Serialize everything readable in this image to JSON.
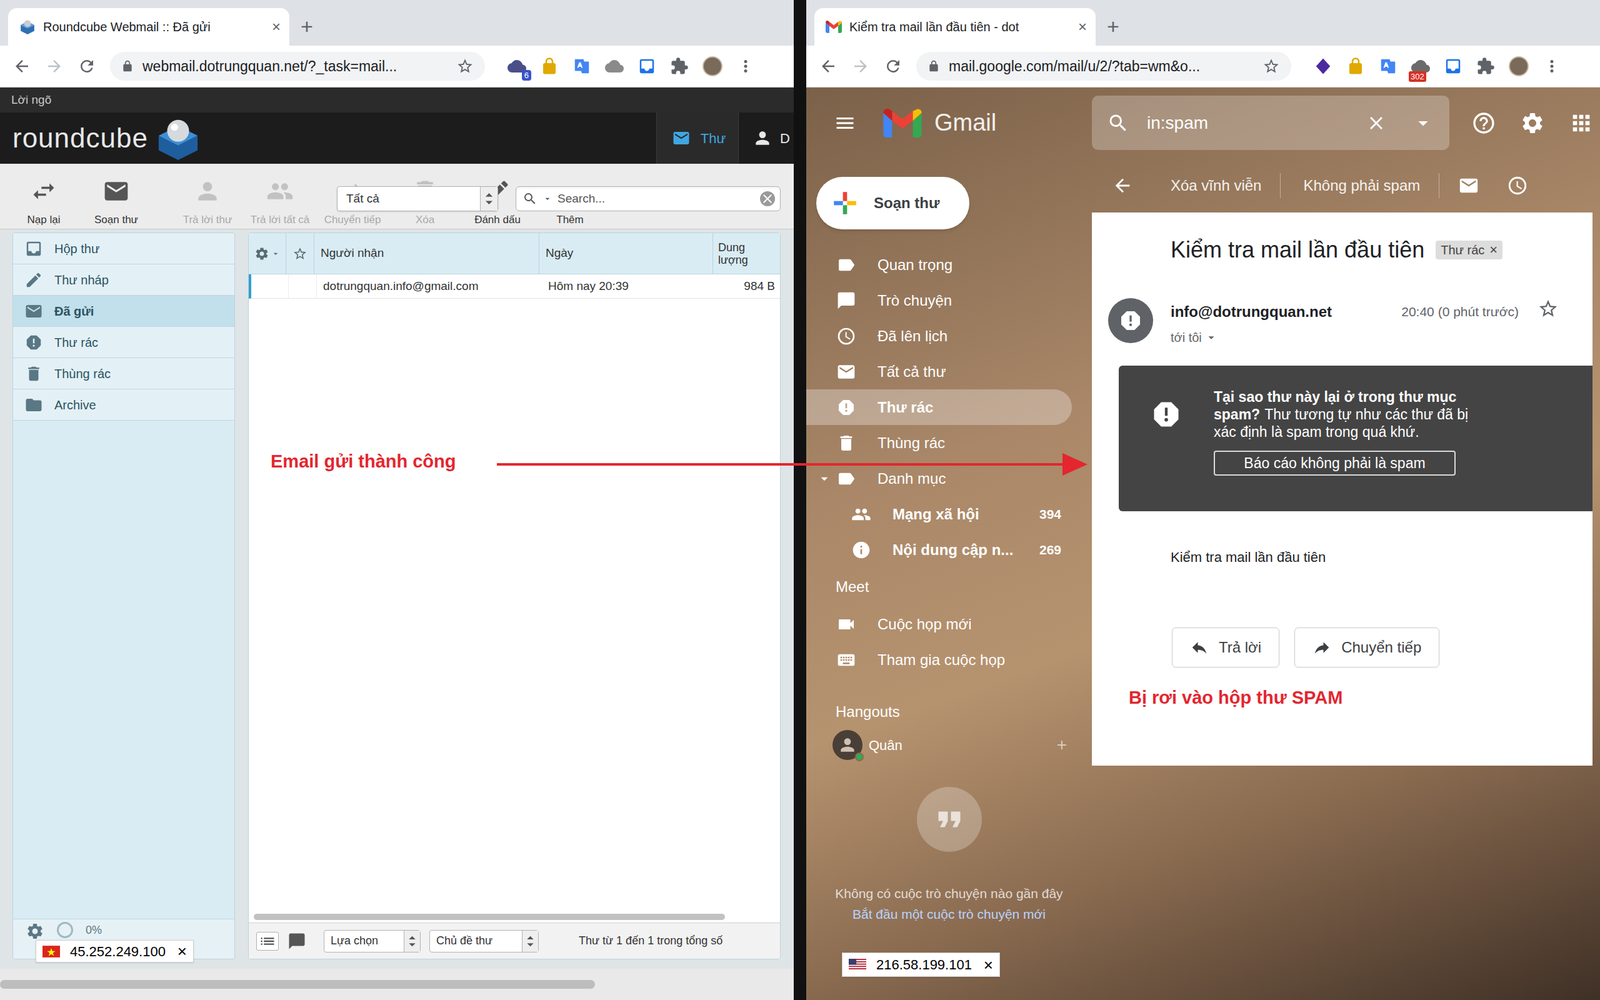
{
  "left_window": {
    "tab": {
      "title": "Roundcube Webmail :: Đã gửi",
      "close": "×"
    },
    "new_tab": "+",
    "url": "webmail.dotrungquan.net/?_task=mail...",
    "extension_badge": "6",
    "bookmarks": [
      "Lời ngõ"
    ]
  },
  "roundcube": {
    "logo": "roundcube",
    "header_tabs": [
      {
        "label": "Thư",
        "selected": true
      },
      {
        "label": "D",
        "selected": false
      }
    ],
    "toolbar": [
      {
        "label": "Nạp lại",
        "disabled": false
      },
      {
        "label": "Soạn thư",
        "disabled": false
      },
      {
        "label": "Trả lời thư",
        "disabled": true
      },
      {
        "label": "Trả lời tất cả",
        "disabled": true
      },
      {
        "label": "Chuyển tiếp",
        "disabled": true
      },
      {
        "label": "Xóa",
        "disabled": true
      },
      {
        "label": "Đánh dấu",
        "disabled": false
      },
      {
        "label": "Thêm",
        "disabled": false
      }
    ],
    "filter": "Tất cả",
    "search": {
      "placeholder": "Search..."
    },
    "folders": [
      {
        "label": "Hộp thư",
        "selected": false
      },
      {
        "label": "Thư nháp",
        "selected": false
      },
      {
        "label": "Đã gửi",
        "selected": true
      },
      {
        "label": "Thư rác",
        "selected": false
      },
      {
        "label": "Thùng rác",
        "selected": false
      },
      {
        "label": "Archive",
        "selected": false
      }
    ],
    "table": {
      "columns": [
        "Người nhận",
        "Ngày",
        "Dung lượng"
      ],
      "rows": [
        {
          "cells": [
            "dotrungquan.info@gmail.com",
            "Hôm nay 20:39",
            "984 B"
          ],
          "focused": true
        }
      ]
    },
    "footer": {
      "selection": "Lựa chọn",
      "threads": "Chủ đề thư",
      "count": "Thư từ 1 đến 1 trong tổng số",
      "quota": "0%"
    }
  },
  "right_window": {
    "tab": {
      "title": "Kiểm tra mail lần đầu tiên - dot",
      "close": "×"
    },
    "new_tab": "+",
    "url": "mail.google.com/mail/u/2/?tab=wm&o...",
    "extension_badge": "302"
  },
  "gmail": {
    "logo": "Gmail",
    "search": {
      "value": "in:spam"
    },
    "compose": "Soạn thư",
    "nav": [
      {
        "label": "Quan trọng",
        "kind": "main",
        "selected": false,
        "unread": false
      },
      {
        "label": "Trò chuyện",
        "kind": "main",
        "selected": false,
        "unread": false
      },
      {
        "label": "Đã lên lịch",
        "kind": "main",
        "selected": false,
        "unread": false
      },
      {
        "label": "Tất cả thư",
        "kind": "main",
        "selected": false,
        "unread": false
      },
      {
        "label": "Thư rác",
        "kind": "main",
        "selected": true,
        "unread": false
      },
      {
        "label": "Thùng rác",
        "kind": "main",
        "selected": false,
        "unread": false
      },
      {
        "label": "Danh mục",
        "kind": "main",
        "selected": false,
        "unread": false,
        "expanded": true
      },
      {
        "label": "Mạng xã hội",
        "kind": "sub",
        "selected": false,
        "unread": true,
        "count": "394"
      },
      {
        "label": "Nội dung cập n...",
        "kind": "sub",
        "selected": false,
        "unread": true,
        "count": "269"
      }
    ],
    "meet": {
      "title": "Meet",
      "items": [
        "Cuộc họp mới",
        "Tham gia cuộc họp"
      ]
    },
    "hangouts": {
      "title": "Hangouts",
      "user": {
        "name": "Quân",
        "online": true
      },
      "add": "+",
      "empty": "Không có cuộc trò chuyện nào gần đây",
      "start": "Bắt đầu một cuộc trò chuyện mới"
    },
    "actions": [
      "Xóa vĩnh viễn",
      "Không phải spam"
    ],
    "message": {
      "subject": "Kiểm tra mail lần đầu tiên",
      "label": {
        "text": "Thư rác",
        "close": "×"
      },
      "sender": "info@dotrungquan.net",
      "time": "20:40 (0 phút trước)",
      "recipient": "tới tôi",
      "starred": false,
      "warning": {
        "title": "Tại sao thư này lại ở trong thư mục spam?",
        "text": "Thư tương tự như các thư đã bị xác định là spam trong quá khứ.",
        "button": "Báo cáo không phải là spam"
      },
      "body": "Kiểm tra mail lần đầu tiên",
      "buttons": [
        "Trả lời",
        "Chuyển tiếp"
      ]
    }
  },
  "ip_badges": [
    {
      "ip": "45.252.249.100",
      "close": "×",
      "kind": "vn"
    },
    {
      "ip": "216.58.199.101",
      "close": "×",
      "kind": "us"
    }
  ],
  "annotations": [
    {
      "text": "Email gửi thành công"
    },
    {
      "text": "Bị rơi vào hộp thư SPAM"
    }
  ]
}
